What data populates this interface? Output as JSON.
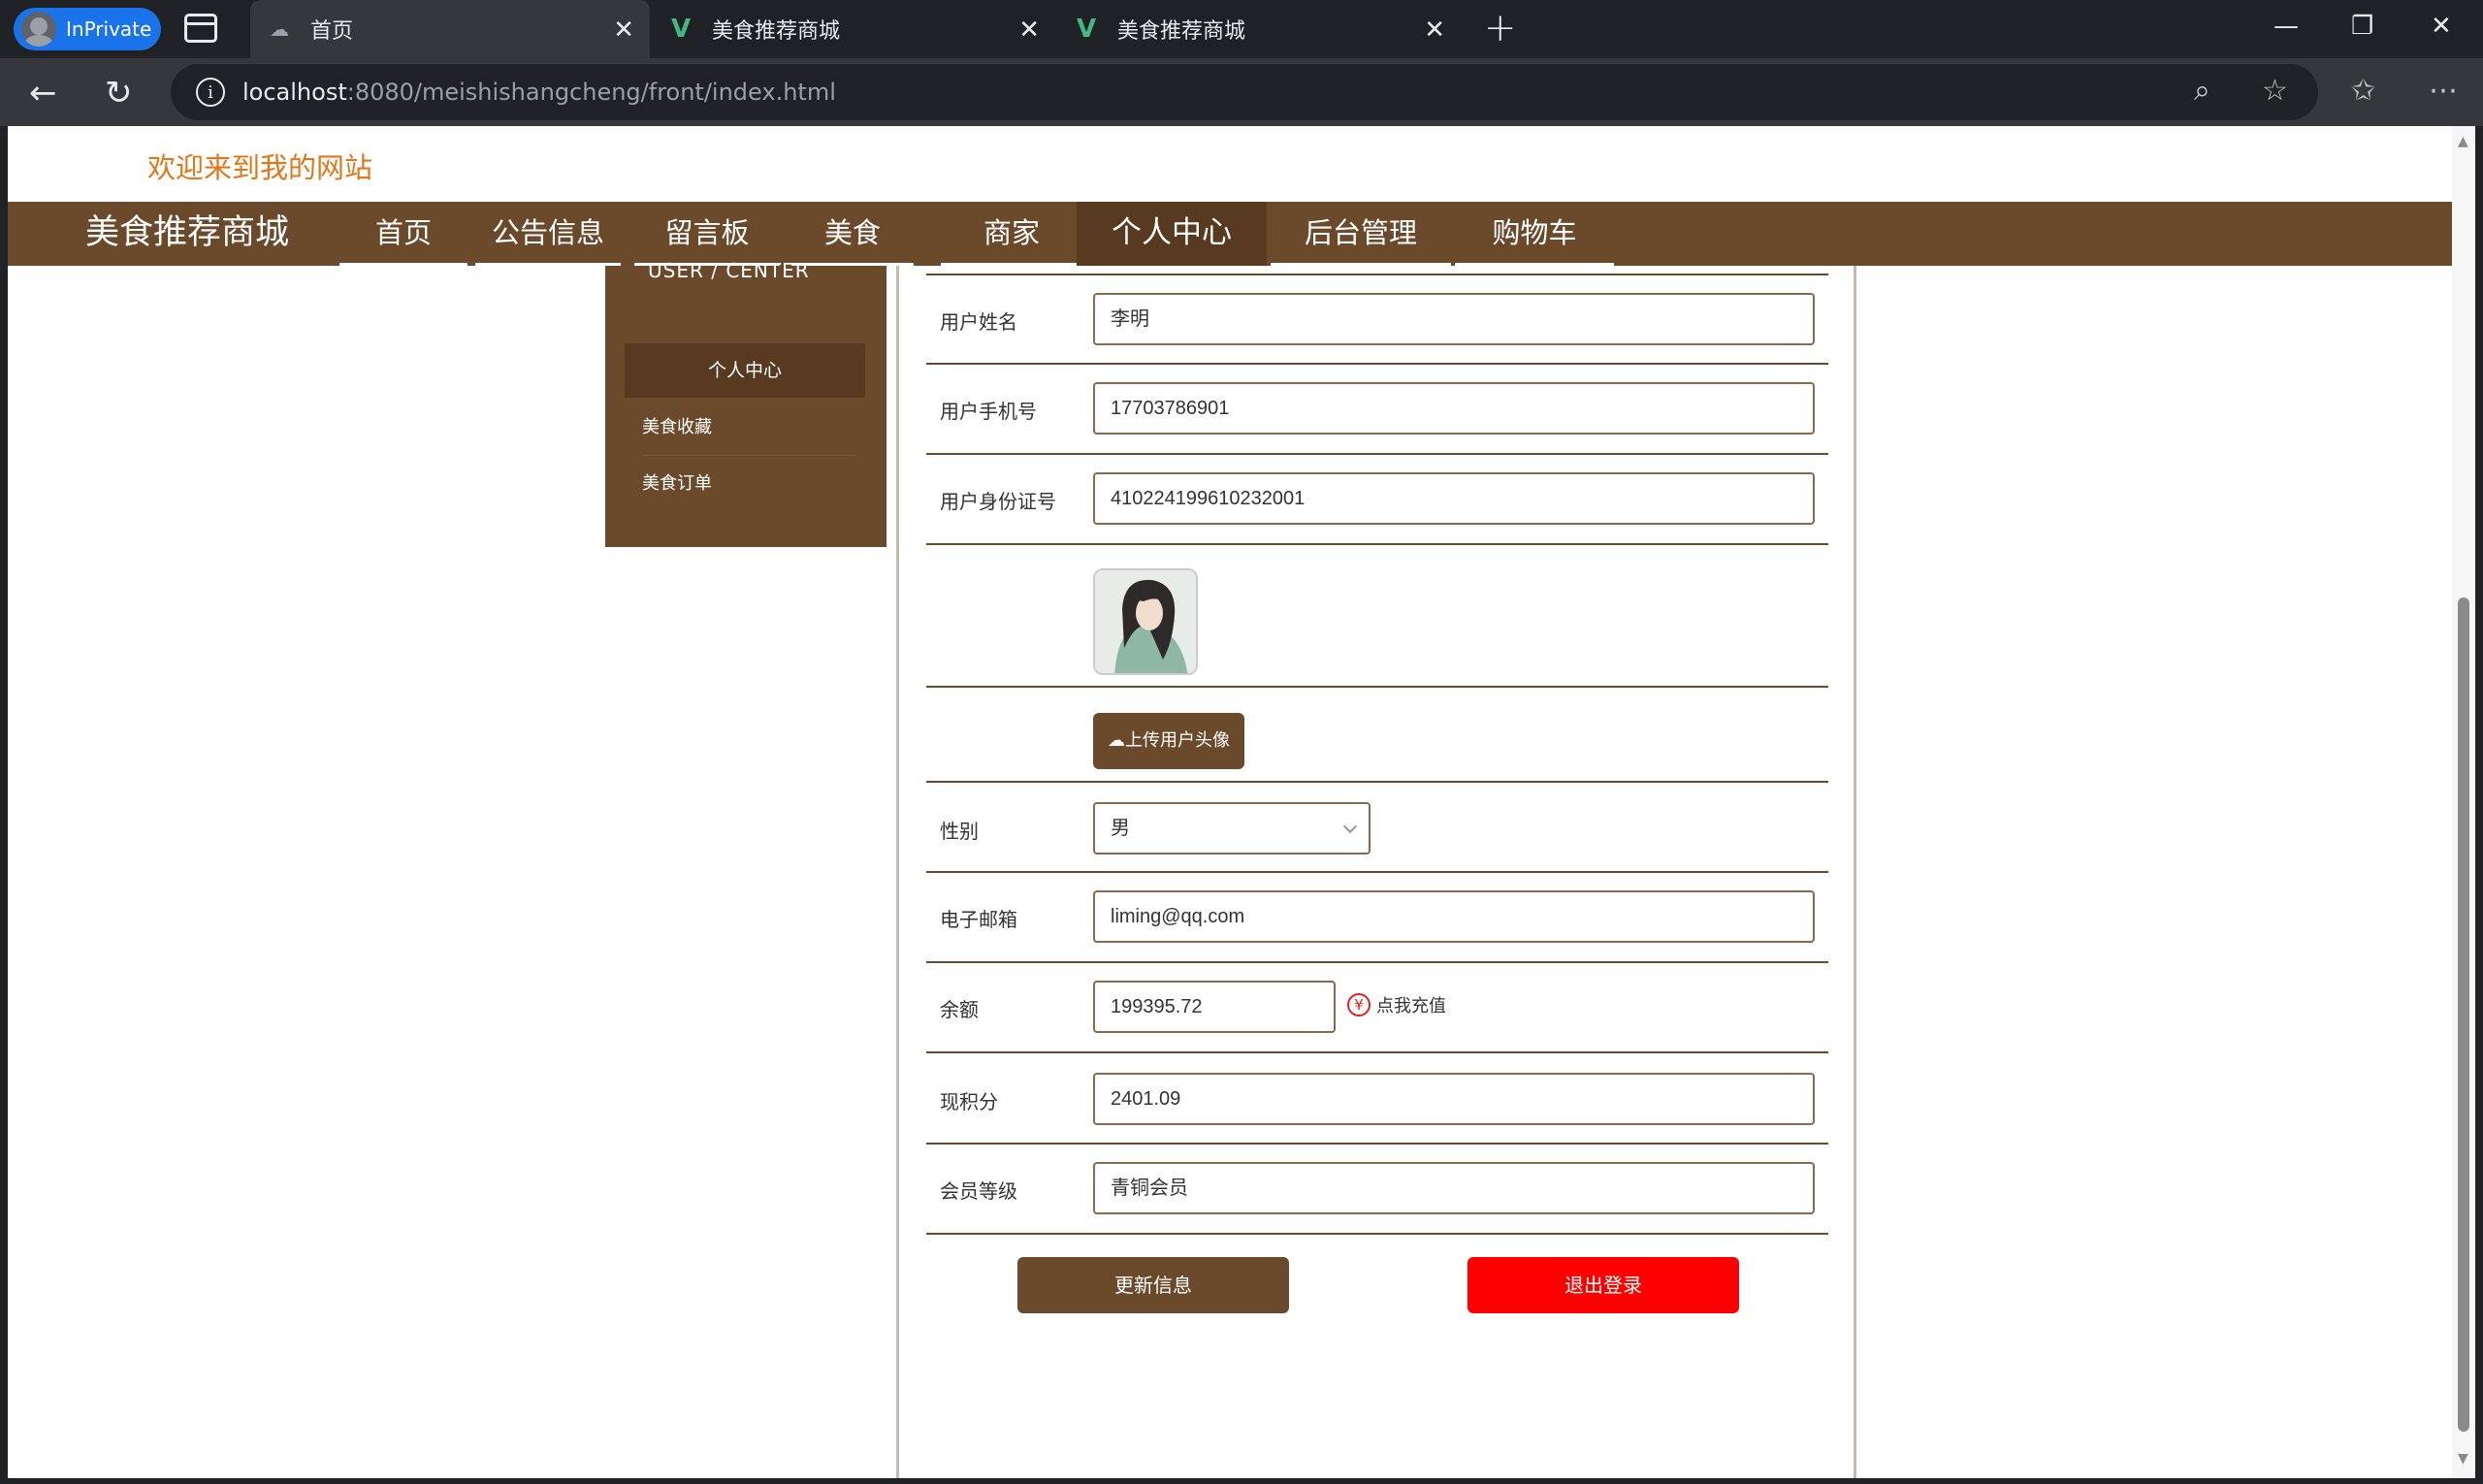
{
  "browser": {
    "inprivate_label": "InPrivate",
    "tabs": [
      {
        "title": "首页"
      },
      {
        "title": "美食推荐商城",
        "favicon": "V"
      },
      {
        "title": "美食推荐商城",
        "favicon": "V"
      }
    ],
    "url_host": "localhost",
    "url_rest": ":8080/meishishangcheng/front/index.html"
  },
  "page": {
    "welcome": "欢迎来到我的网站",
    "brand": "美食推荐商城",
    "nav": [
      "首页",
      "公告信息",
      "留言板",
      "美食",
      "商家",
      "个人中心",
      "后台管理",
      "购物车"
    ],
    "nav_active": "个人中心",
    "side": {
      "title": "USER / CENTER",
      "items": [
        "个人中心",
        "美食收藏",
        "美食订单"
      ]
    },
    "form": {
      "name_label": "用户姓名",
      "name_value": "李明",
      "phone_label": "用户手机号",
      "phone_value": "17703786901",
      "idcard_label": "用户身份证号",
      "idcard_value": "410224199610232001",
      "upload_label": "上传用户头像",
      "gender_label": "性别",
      "gender_value": "男",
      "email_label": "电子邮箱",
      "email_value": "liming@qq.com",
      "balance_label": "余额",
      "balance_value": "199395.72",
      "recharge_label": "点我充值",
      "points_label": "现积分",
      "points_value": "2401.09",
      "level_label": "会员等级",
      "level_value": "青铜会员"
    },
    "buttons": {
      "update": "更新信息",
      "logout": "退出登录"
    }
  },
  "colors": {
    "brown": "#6b4a2c",
    "dark_brown": "#583a20",
    "orange": "#e0771a",
    "red": "#ff0000"
  }
}
